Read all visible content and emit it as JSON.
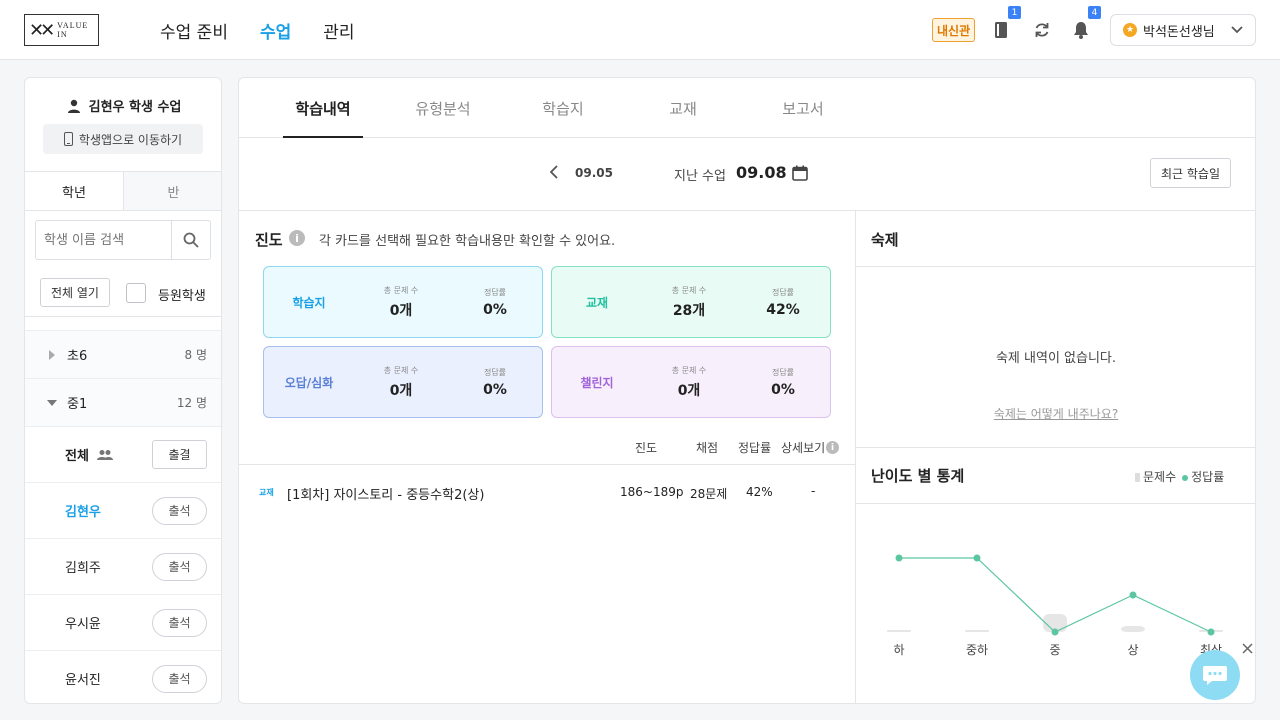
{
  "header": {
    "logo_text": "VALUE IN",
    "nav": [
      "수업 준비",
      "수업",
      "관리"
    ],
    "tag_label": "내신관",
    "book_badge": "1",
    "bell_badge": "4",
    "user_name": "박석돈선생님"
  },
  "sidebar": {
    "student_title": "김현우 학생 수업",
    "student_app_btn": "학생앱으로 이동하기",
    "tabs": [
      "학년",
      "반"
    ],
    "search_placeholder": "학생 이름 검색",
    "expand_all": "전체 열기",
    "enrolled_label": "등원학생",
    "groups": [
      {
        "name": "초6",
        "count": "8 명"
      },
      {
        "name": "중1",
        "count": "12 명"
      }
    ],
    "all_label": "전체",
    "absent_btn": "출결",
    "students": [
      {
        "name": "김현우",
        "status": "출석"
      },
      {
        "name": "김희주",
        "status": "출석"
      },
      {
        "name": "우시윤",
        "status": "출석"
      },
      {
        "name": "윤서진",
        "status": "출석"
      }
    ]
  },
  "main": {
    "tabs": [
      "학습내역",
      "유형분석",
      "학습지",
      "교재",
      "보고서"
    ],
    "prev_date": "09.05",
    "last_class_label": "지난 수업",
    "last_class_date": "09.08",
    "recent_btn": "최근 학습일",
    "progress": {
      "title": "진도",
      "hint": "각 카드를 선택해 필요한 학습내용만 확인할 수 있어요.",
      "cards": [
        {
          "title": "학습지",
          "count_label": "총 문제 수",
          "count": "0개",
          "rate_label": "정답률",
          "rate": "0%"
        },
        {
          "title": "교재",
          "count_label": "총 문제 수",
          "count": "28개",
          "rate_label": "정답률",
          "rate": "42%"
        },
        {
          "title": "오답/심화",
          "count_label": "총 문제 수",
          "count": "0개",
          "rate_label": "정답률",
          "rate": "0%"
        },
        {
          "title": "챌린지",
          "count_label": "총 문제 수",
          "count": "0개",
          "rate_label": "정답률",
          "rate": "0%"
        }
      ],
      "columns": [
        "진도",
        "채점",
        "정답률",
        "상세보기"
      ],
      "rows": [
        {
          "tag": "교재",
          "title": "[1회차] 자이스토리 - 중등수학2(상)",
          "pages": "186~189p",
          "score": "28문제",
          "rate": "42%",
          "detail": "-"
        }
      ]
    },
    "homework": {
      "title": "숙제",
      "empty": "숙제 내역이 없습니다.",
      "help_link": "숙제는 어떻게 내주나요?"
    },
    "stats": {
      "title": "난이도 별 통계",
      "legend": [
        "문제수",
        "정답률"
      ]
    },
    "colors": {
      "accent": "#1aa0e6",
      "line": "#5cc6a0"
    }
  },
  "chart_data": {
    "type": "bar",
    "categories": [
      "하",
      "중하",
      "중",
      "상",
      "최상"
    ],
    "series": [
      {
        "name": "문제수",
        "values": [
          0,
          1,
          9,
          3,
          0
        ]
      },
      {
        "name": "정답률",
        "values": [
          100,
          100,
          0,
          50,
          0
        ]
      }
    ],
    "legend": "top-right"
  }
}
